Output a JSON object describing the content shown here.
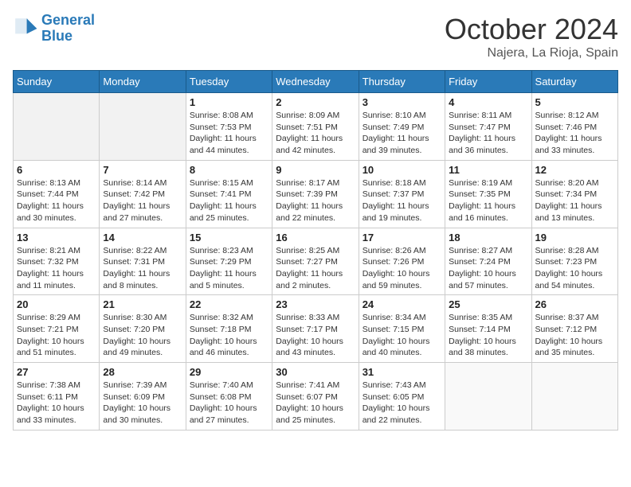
{
  "header": {
    "logo_line1": "General",
    "logo_line2": "Blue",
    "month_title": "October 2024",
    "location": "Najera, La Rioja, Spain"
  },
  "weekdays": [
    "Sunday",
    "Monday",
    "Tuesday",
    "Wednesday",
    "Thursday",
    "Friday",
    "Saturday"
  ],
  "weeks": [
    [
      {
        "day": "",
        "detail": ""
      },
      {
        "day": "",
        "detail": ""
      },
      {
        "day": "1",
        "detail": "Sunrise: 8:08 AM\nSunset: 7:53 PM\nDaylight: 11 hours and 44 minutes."
      },
      {
        "day": "2",
        "detail": "Sunrise: 8:09 AM\nSunset: 7:51 PM\nDaylight: 11 hours and 42 minutes."
      },
      {
        "day": "3",
        "detail": "Sunrise: 8:10 AM\nSunset: 7:49 PM\nDaylight: 11 hours and 39 minutes."
      },
      {
        "day": "4",
        "detail": "Sunrise: 8:11 AM\nSunset: 7:47 PM\nDaylight: 11 hours and 36 minutes."
      },
      {
        "day": "5",
        "detail": "Sunrise: 8:12 AM\nSunset: 7:46 PM\nDaylight: 11 hours and 33 minutes."
      }
    ],
    [
      {
        "day": "6",
        "detail": "Sunrise: 8:13 AM\nSunset: 7:44 PM\nDaylight: 11 hours and 30 minutes."
      },
      {
        "day": "7",
        "detail": "Sunrise: 8:14 AM\nSunset: 7:42 PM\nDaylight: 11 hours and 27 minutes."
      },
      {
        "day": "8",
        "detail": "Sunrise: 8:15 AM\nSunset: 7:41 PM\nDaylight: 11 hours and 25 minutes."
      },
      {
        "day": "9",
        "detail": "Sunrise: 8:17 AM\nSunset: 7:39 PM\nDaylight: 11 hours and 22 minutes."
      },
      {
        "day": "10",
        "detail": "Sunrise: 8:18 AM\nSunset: 7:37 PM\nDaylight: 11 hours and 19 minutes."
      },
      {
        "day": "11",
        "detail": "Sunrise: 8:19 AM\nSunset: 7:35 PM\nDaylight: 11 hours and 16 minutes."
      },
      {
        "day": "12",
        "detail": "Sunrise: 8:20 AM\nSunset: 7:34 PM\nDaylight: 11 hours and 13 minutes."
      }
    ],
    [
      {
        "day": "13",
        "detail": "Sunrise: 8:21 AM\nSunset: 7:32 PM\nDaylight: 11 hours and 11 minutes."
      },
      {
        "day": "14",
        "detail": "Sunrise: 8:22 AM\nSunset: 7:31 PM\nDaylight: 11 hours and 8 minutes."
      },
      {
        "day": "15",
        "detail": "Sunrise: 8:23 AM\nSunset: 7:29 PM\nDaylight: 11 hours and 5 minutes."
      },
      {
        "day": "16",
        "detail": "Sunrise: 8:25 AM\nSunset: 7:27 PM\nDaylight: 11 hours and 2 minutes."
      },
      {
        "day": "17",
        "detail": "Sunrise: 8:26 AM\nSunset: 7:26 PM\nDaylight: 10 hours and 59 minutes."
      },
      {
        "day": "18",
        "detail": "Sunrise: 8:27 AM\nSunset: 7:24 PM\nDaylight: 10 hours and 57 minutes."
      },
      {
        "day": "19",
        "detail": "Sunrise: 8:28 AM\nSunset: 7:23 PM\nDaylight: 10 hours and 54 minutes."
      }
    ],
    [
      {
        "day": "20",
        "detail": "Sunrise: 8:29 AM\nSunset: 7:21 PM\nDaylight: 10 hours and 51 minutes."
      },
      {
        "day": "21",
        "detail": "Sunrise: 8:30 AM\nSunset: 7:20 PM\nDaylight: 10 hours and 49 minutes."
      },
      {
        "day": "22",
        "detail": "Sunrise: 8:32 AM\nSunset: 7:18 PM\nDaylight: 10 hours and 46 minutes."
      },
      {
        "day": "23",
        "detail": "Sunrise: 8:33 AM\nSunset: 7:17 PM\nDaylight: 10 hours and 43 minutes."
      },
      {
        "day": "24",
        "detail": "Sunrise: 8:34 AM\nSunset: 7:15 PM\nDaylight: 10 hours and 40 minutes."
      },
      {
        "day": "25",
        "detail": "Sunrise: 8:35 AM\nSunset: 7:14 PM\nDaylight: 10 hours and 38 minutes."
      },
      {
        "day": "26",
        "detail": "Sunrise: 8:37 AM\nSunset: 7:12 PM\nDaylight: 10 hours and 35 minutes."
      }
    ],
    [
      {
        "day": "27",
        "detail": "Sunrise: 7:38 AM\nSunset: 6:11 PM\nDaylight: 10 hours and 33 minutes."
      },
      {
        "day": "28",
        "detail": "Sunrise: 7:39 AM\nSunset: 6:09 PM\nDaylight: 10 hours and 30 minutes."
      },
      {
        "day": "29",
        "detail": "Sunrise: 7:40 AM\nSunset: 6:08 PM\nDaylight: 10 hours and 27 minutes."
      },
      {
        "day": "30",
        "detail": "Sunrise: 7:41 AM\nSunset: 6:07 PM\nDaylight: 10 hours and 25 minutes."
      },
      {
        "day": "31",
        "detail": "Sunrise: 7:43 AM\nSunset: 6:05 PM\nDaylight: 10 hours and 22 minutes."
      },
      {
        "day": "",
        "detail": ""
      },
      {
        "day": "",
        "detail": ""
      }
    ]
  ]
}
